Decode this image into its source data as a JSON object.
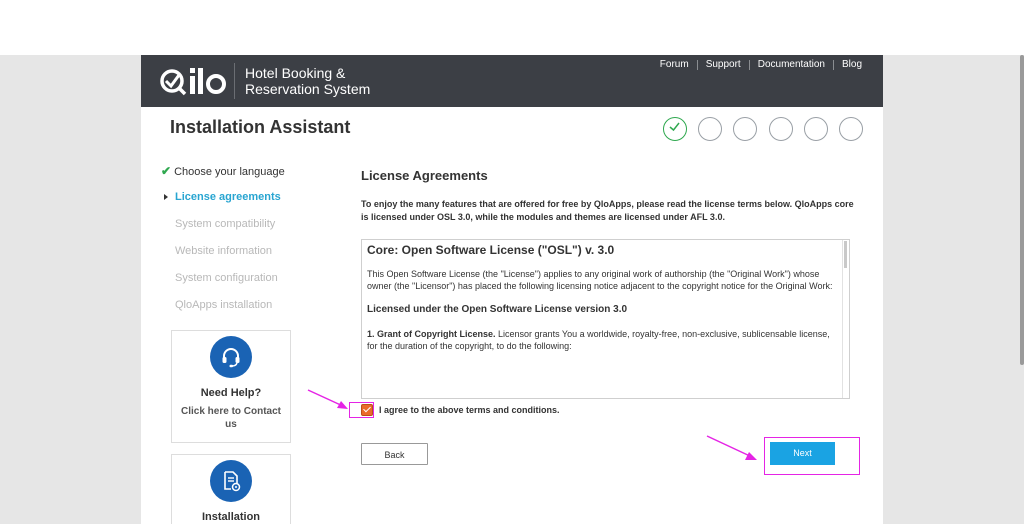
{
  "header": {
    "brand_line1": "Hotel Booking &",
    "brand_line2": "Reservation System",
    "links": [
      "Forum",
      "Support",
      "Documentation",
      "Blog"
    ]
  },
  "page_title": "Installation Assistant",
  "progress": {
    "total_steps": 6,
    "completed_steps": 1
  },
  "sidebar": {
    "steps": [
      {
        "label": "Choose your language",
        "state": "done"
      },
      {
        "label": "License agreements",
        "state": "active"
      },
      {
        "label": "System compatibility",
        "state": "pending"
      },
      {
        "label": "Website information",
        "state": "pending"
      },
      {
        "label": "System configuration",
        "state": "pending"
      },
      {
        "label": "QloApps installation",
        "state": "pending"
      }
    ],
    "help_card": {
      "title": "Need Help?",
      "subtitle": "Click here to Contact us"
    },
    "install_card": {
      "title": "Installation"
    }
  },
  "main": {
    "section_title": "License Agreements",
    "intro": "To enjoy the many features that are offered for free by QloApps, please read the license terms below. QloApps core is licensed under OSL 3.0, while the modules and themes are licensed under AFL 3.0.",
    "license": {
      "heading": "Core: Open Software License (\"OSL\") v. 3.0",
      "para1": "This Open Software License (the \"License\") applies to any original work of authorship (the \"Original Work\") whose owner (the \"Licensor\") has placed the following licensing notice adjacent to the copyright notice for the Original Work:",
      "subheading": "Licensed under the Open Software License version 3.0",
      "grant_title": "1. Grant of Copyright License.",
      "grant_text": " Licensor grants You a worldwide, royalty-free, non-exclusive, sublicensable license, for the duration of the copyright, to do the following:"
    },
    "agree_label": "I agree to the above terms and conditions.",
    "agree_checked": true,
    "back_label": "Back",
    "next_label": "Next"
  },
  "colors": {
    "header_bg": "#3c3f45",
    "active_step": "#28a5d1",
    "done_check": "#2fa84f",
    "next_button": "#1aa3e3",
    "highlight": "#e524e5",
    "checkbox": "#ea6a2a"
  }
}
